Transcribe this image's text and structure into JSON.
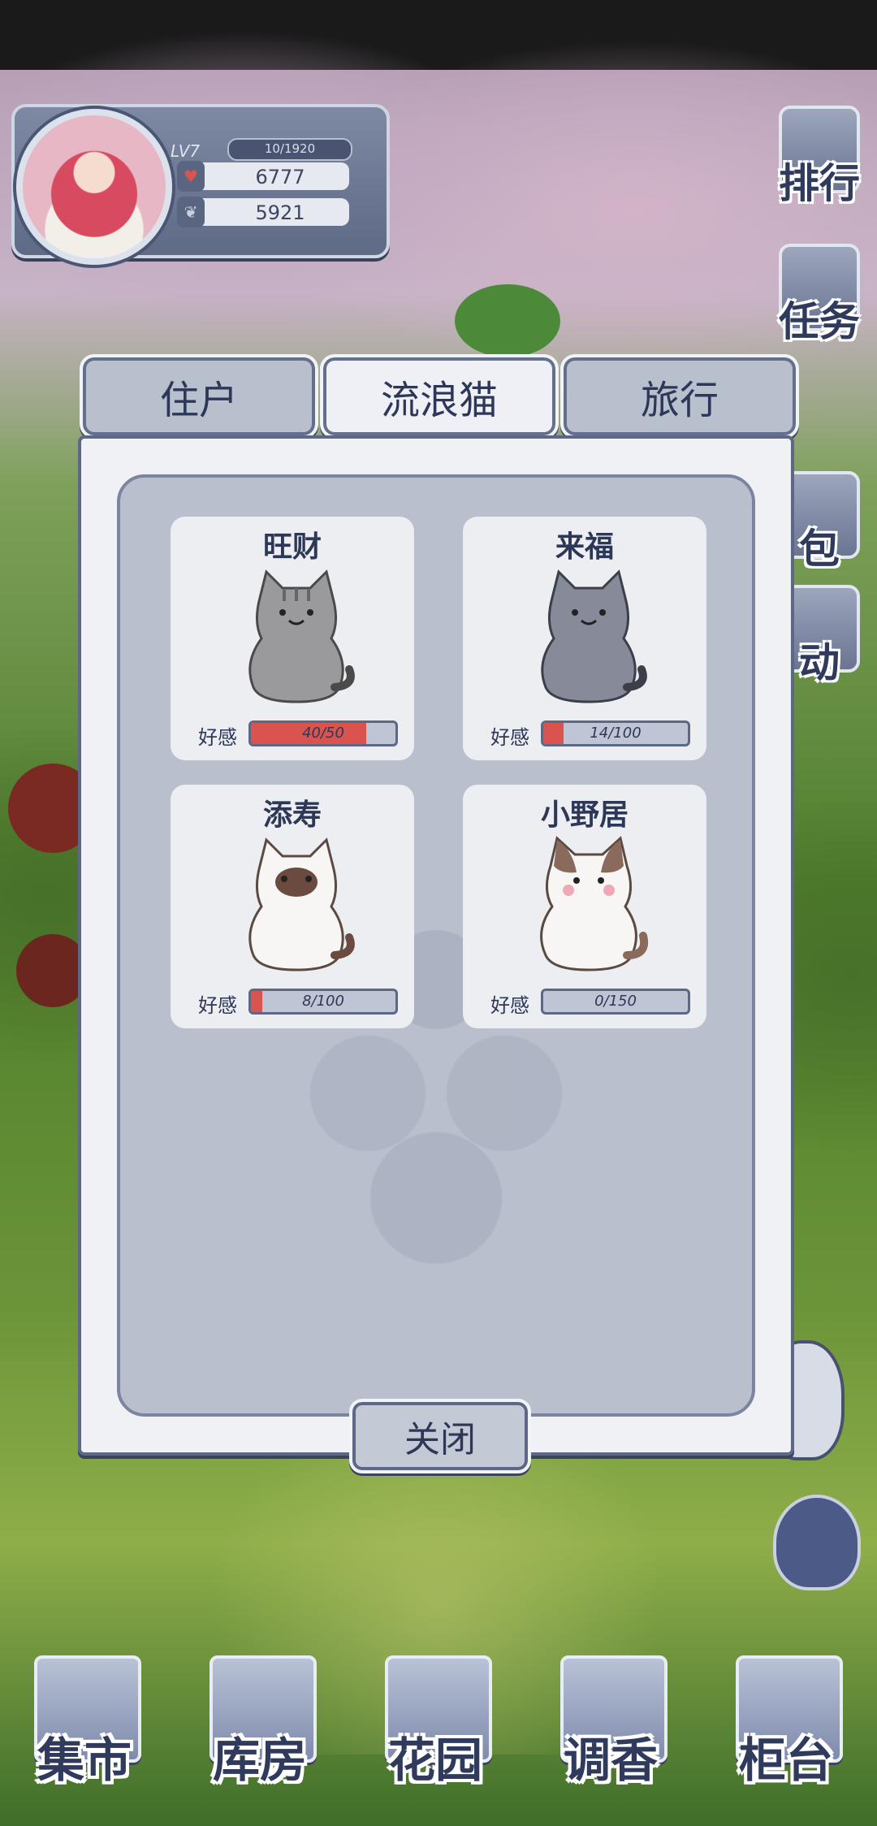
{
  "player": {
    "level": "LV7",
    "exp": "10/1920",
    "hearts": "6777",
    "coins": "5921"
  },
  "side_menu": [
    {
      "label": "排行",
      "icon": "ranking-icon"
    },
    {
      "label": "任务",
      "icon": "task-icon"
    },
    {
      "label": "包",
      "icon": "bag-icon"
    },
    {
      "label": "动",
      "icon": "activity-icon"
    }
  ],
  "tabs": [
    {
      "label": "住户",
      "active": false
    },
    {
      "label": "流浪猫",
      "active": true
    },
    {
      "label": "旅行",
      "active": false
    }
  ],
  "favor_label": "好感",
  "cats": [
    {
      "name": "旺财",
      "favor": "40/50",
      "progress": 0.8,
      "fur": "#9a9a9c",
      "accent": "#9a9a9c"
    },
    {
      "name": "来福",
      "favor": "14/100",
      "progress": 0.14,
      "fur": "#878b99",
      "accent": "#878b99"
    },
    {
      "name": "添寿",
      "favor": "8/100",
      "progress": 0.08,
      "fur": "#f8f6f4",
      "accent": "#6b4a3f"
    },
    {
      "name": "小野居",
      "favor": "0/150",
      "progress": 0.0,
      "fur": "#f8f6f4",
      "accent": "#8a6a5c"
    }
  ],
  "close_label": "关闭",
  "bottom_nav": [
    {
      "label": "集市",
      "icon": "market-gate-icon"
    },
    {
      "label": "库房",
      "icon": "warehouse-icon"
    },
    {
      "label": "花园",
      "icon": "rose-icon"
    },
    {
      "label": "调香",
      "icon": "perfume-icon"
    },
    {
      "label": "柜台",
      "icon": "counter-icon"
    }
  ],
  "colors": {
    "accent_text": "#2d3858",
    "favor_fill": "#d9534f",
    "panel_bg": "#babfcd"
  }
}
